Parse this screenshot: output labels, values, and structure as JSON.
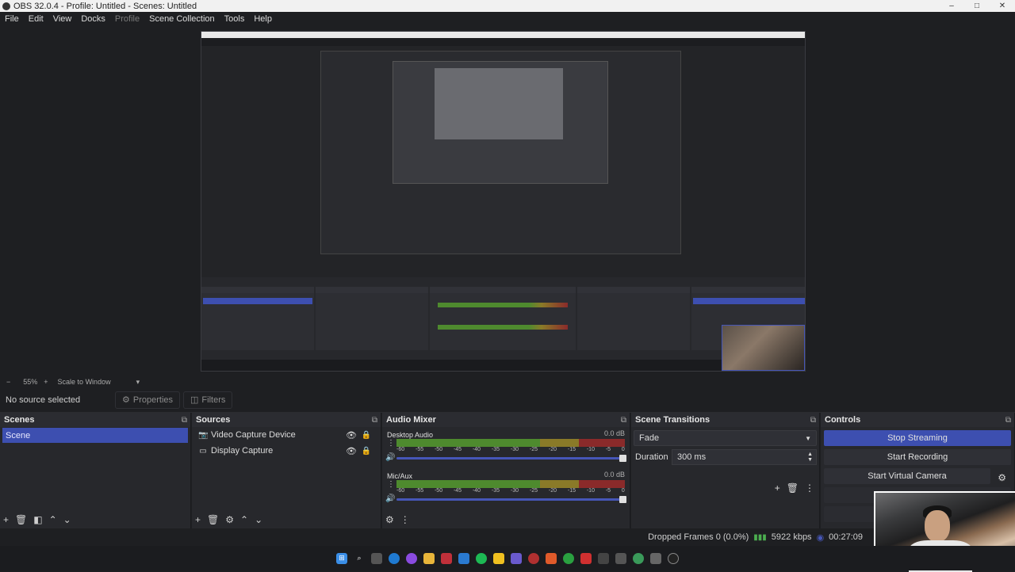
{
  "window": {
    "title": "OBS 32.0.4 - Profile: Untitled - Scenes: Untitled",
    "minimize": "–",
    "maximize": "□",
    "close": "✕"
  },
  "menu": [
    "File",
    "Edit",
    "View",
    "Docks",
    "Profile",
    "Scene Collection",
    "Tools",
    "Help"
  ],
  "zoom": {
    "minus": "−",
    "value": "55%",
    "plus": "+",
    "mode": "Scale to Window",
    "arrow": "▾"
  },
  "context": {
    "no_source": "No source selected",
    "properties": "Properties",
    "filters": "Filters"
  },
  "scenes": {
    "title": "Scenes",
    "items": [
      "Scene"
    ]
  },
  "sources": {
    "title": "Sources",
    "items": [
      {
        "name": "Video Capture Device",
        "icon": "camera-icon"
      },
      {
        "name": "Display Capture",
        "icon": "monitor-icon"
      }
    ]
  },
  "mixer": {
    "title": "Audio Mixer",
    "ticks": [
      "-60",
      "-55",
      "-50",
      "-45",
      "-40",
      "-35",
      "-30",
      "-25",
      "-20",
      "-15",
      "-10",
      "-5",
      "0"
    ],
    "channels": [
      {
        "name": "Desktop Audio",
        "db": "0.0 dB"
      },
      {
        "name": "Mic/Aux",
        "db": "0.0 dB"
      }
    ]
  },
  "transitions": {
    "title": "Scene Transitions",
    "selected": "Fade",
    "duration_label": "Duration",
    "duration_value": "300 ms"
  },
  "controls": {
    "title": "Controls",
    "stop_streaming": "Stop Streaming",
    "start_recording": "Start Recording",
    "start_virtual_camera": "Start Virtual Camera"
  },
  "status": {
    "dropped_frames": "Dropped Frames 0 (0.0%)",
    "bitrate": "5922 kbps",
    "time": "00:27:09"
  },
  "colors": {
    "accent": "#3d4fb0",
    "panel": "#27282c",
    "background": "#1e1f22"
  }
}
